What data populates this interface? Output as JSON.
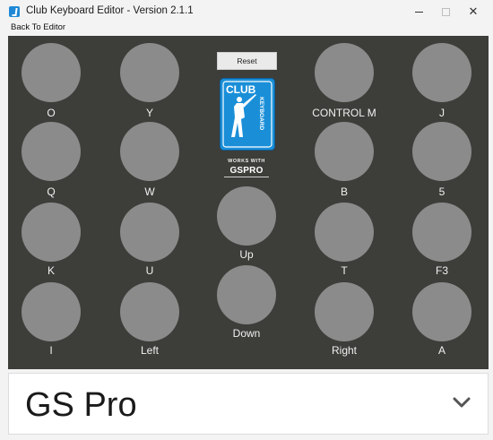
{
  "window": {
    "title": "Club Keyboard Editor - Version 2.1.1",
    "controls": {
      "minimize": "minimize",
      "maximize": "maximize",
      "close": "✕"
    }
  },
  "menu": {
    "back_to_editor": "Back To Editor"
  },
  "reset_label": "Reset",
  "logo": {
    "club": "CLUB",
    "keyboard": "KEYBOARD",
    "works_with": "WORKS WITH",
    "partner": "GSPRO"
  },
  "keys": {
    "r0c0": "O",
    "r0c1": "Y",
    "r0c3": "CONTROL M",
    "r0c4": "J",
    "r1c0": "Q",
    "r1c1": "W",
    "r1c3": "B",
    "r1c4": "5",
    "r2c0": "K",
    "r2c1": "U",
    "r2c2": "Up",
    "r2c3": "T",
    "r2c4": "F3",
    "r3c0": "I",
    "r3c1": "Left",
    "r3c2": "Down",
    "r3c3": "Right",
    "r3c4": "A"
  },
  "profile_select": {
    "selected": "GS Pro"
  },
  "colors": {
    "panel_bg": "#3d3e3a",
    "key_fill": "#8b8b8b",
    "logo_blue": "#1a8fd8"
  }
}
